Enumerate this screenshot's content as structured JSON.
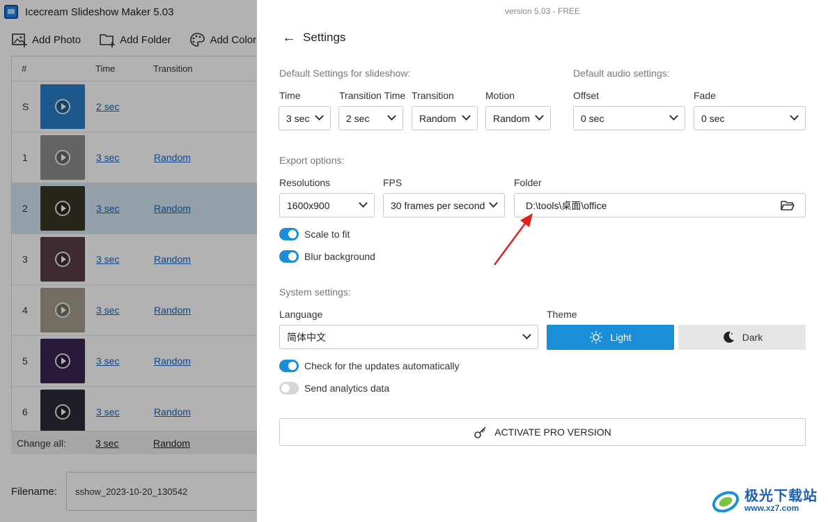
{
  "app": {
    "title": "Icecream Slideshow Maker 5.03",
    "toolbar": {
      "add_photo": "Add Photo",
      "add_folder": "Add Folder",
      "add_color": "Add Color"
    },
    "table": {
      "col_num": "#",
      "col_time": "Time",
      "col_transition": "Transition",
      "rows": [
        {
          "num": "S",
          "time": "2 sec",
          "transition": "",
          "thumb_color": "#2a7fc9"
        },
        {
          "num": "1",
          "time": "3 sec",
          "transition": "Random",
          "thumb_color": "#8f8f8f"
        },
        {
          "num": "2",
          "time": "3 sec",
          "transition": "Random",
          "thumb_color": "#3a3528"
        },
        {
          "num": "3",
          "time": "3 sec",
          "transition": "Random",
          "thumb_color": "#5a3e44"
        },
        {
          "num": "4",
          "time": "3 sec",
          "transition": "Random",
          "thumb_color": "#a49b8c"
        },
        {
          "num": "5",
          "time": "3 sec",
          "transition": "Random",
          "thumb_color": "#3a2455"
        },
        {
          "num": "6",
          "time": "3 sec",
          "transition": "Random",
          "thumb_color": "#2c2c3a"
        }
      ]
    },
    "change_all": {
      "label": "Change all:",
      "time": "3 sec",
      "transition": "Random"
    },
    "filename": {
      "label": "Filename:",
      "value": "sshow_2023-10-20_130542"
    }
  },
  "settings": {
    "version": "version 5.03 - FREE",
    "title": "Settings",
    "slideshow_section": "Default Settings for slideshow:",
    "audio_section": "Default audio settings:",
    "time_label": "Time",
    "time_value": "3 sec",
    "transition_time_label": "Transition Time",
    "transition_time_value": "2 sec",
    "transition_label": "Transition",
    "transition_value": "Random",
    "motion_label": "Motion",
    "motion_value": "Random",
    "offset_label": "Offset",
    "offset_value": "0 sec",
    "fade_label": "Fade",
    "fade_value": "0 sec",
    "export_section": "Export options:",
    "resolutions_label": "Resolutions",
    "resolutions_value": "1600x900",
    "fps_label": "FPS",
    "fps_value": "30 frames per second",
    "folder_label": "Folder",
    "folder_value": "D:\\tools\\桌面\\office",
    "scale_to_fit": "Scale to fit",
    "blur_background": "Blur background",
    "system_section": "System settings:",
    "language_label": "Language",
    "language_value": "简体中文",
    "theme_label": "Theme",
    "theme_light": "Light",
    "theme_dark": "Dark",
    "check_updates": "Check for the updates automatically",
    "send_analytics": "Send analytics data",
    "activate_pro": "ACTIVATE PRO VERSION",
    "toggles": {
      "scale_to_fit": true,
      "blur_background": true,
      "check_updates": true,
      "send_analytics": false
    }
  },
  "watermark": {
    "cn": "极光下载站",
    "url": "www.xz7.com"
  },
  "colors": {
    "accent": "#1a8fd8",
    "link": "#1565c0",
    "annotation_arrow": "#e02020"
  }
}
